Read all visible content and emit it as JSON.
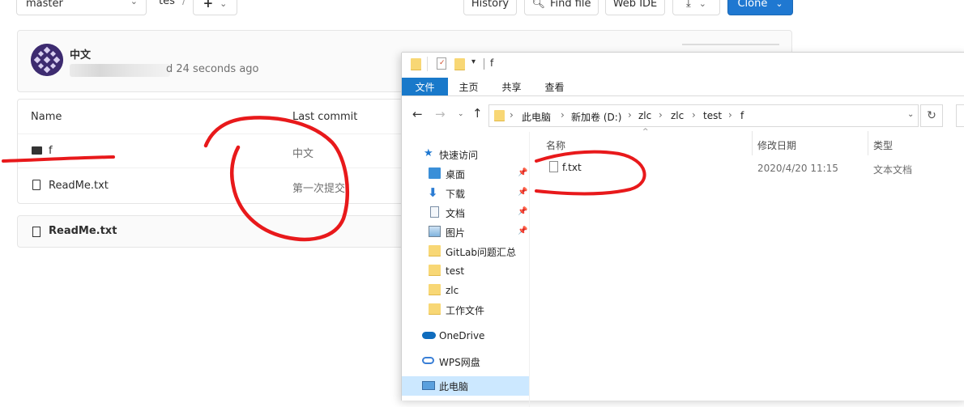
{
  "gitlab": {
    "branch": "master",
    "breadcrumb_repo": "tes",
    "breadcrumb_sep": "/",
    "add_label": "+",
    "history_label": "History",
    "find_file_label": "Find file",
    "web_ide_label": "Web IDE",
    "clone_label": "Clone",
    "commit": {
      "title": "中文",
      "time_suffix": "d 24 seconds ago"
    },
    "tree": {
      "col_name": "Name",
      "col_last_commit": "Last commit",
      "rows": [
        {
          "name": "f",
          "type": "folder",
          "commit": "中文"
        },
        {
          "name": "ReadMe.txt",
          "type": "file",
          "commit": "第一次提交"
        }
      ]
    },
    "readme_title": "ReadMe.txt"
  },
  "explorer": {
    "title": "f",
    "ribbon_tabs": [
      "文件",
      "主页",
      "共享",
      "查看"
    ],
    "address": [
      "此电脑",
      "新加卷 (D:)",
      "zlc",
      "zlc",
      "test",
      "f"
    ],
    "columns": {
      "name": "名称",
      "date": "修改日期",
      "type": "类型"
    },
    "files": [
      {
        "name": "f.txt",
        "date": "2020/4/20 11:15",
        "type": "文本文档"
      }
    ],
    "nav": [
      {
        "label": "快速访问",
        "icon": "star-icon"
      },
      {
        "label": "桌面",
        "icon": "desktop-icon",
        "pinned": true
      },
      {
        "label": "下载",
        "icon": "download-icon",
        "pinned": true
      },
      {
        "label": "文档",
        "icon": "document-icon",
        "pinned": true
      },
      {
        "label": "图片",
        "icon": "picture-icon",
        "pinned": true
      },
      {
        "label": "GitLab问题汇总",
        "icon": "folder-icon"
      },
      {
        "label": "test",
        "icon": "folder-icon"
      },
      {
        "label": "zlc",
        "icon": "folder-icon"
      },
      {
        "label": "工作文件",
        "icon": "folder-icon"
      },
      {
        "label": "OneDrive",
        "icon": "cloud-icon"
      },
      {
        "label": "WPS网盘",
        "icon": "wps-cloud-icon"
      },
      {
        "label": "此电脑",
        "icon": "computer-icon"
      }
    ],
    "pin_glyph": "📌"
  },
  "colors": {
    "gitlab_primary": "#1f78d1",
    "explorer_file_tab": "#1979ca",
    "annotation_red": "#e8191b",
    "folder_yellow": "#f8d775"
  }
}
